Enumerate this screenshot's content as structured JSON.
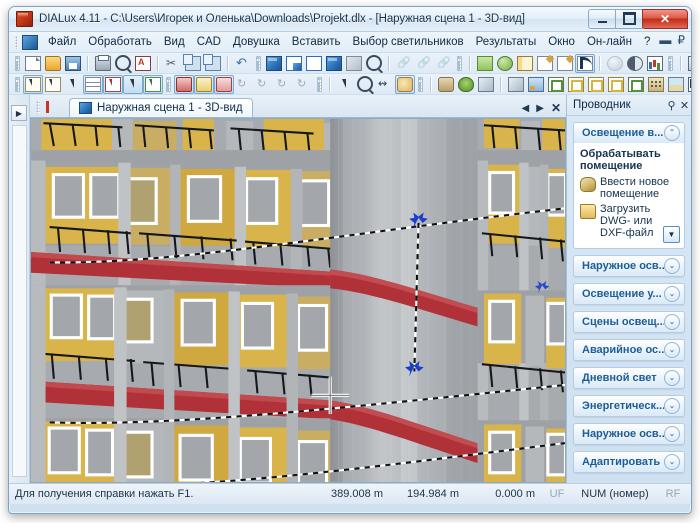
{
  "window": {
    "title": "DIALux 4.11 - C:\\Users\\Игорек и Оленька\\Downloads\\Projekt.dlx - [Наружная сцена 1 - 3D-вид]",
    "app_icon": "dialux-icon",
    "buttons": {
      "minimize": "–",
      "maximize": "□",
      "close": "✕"
    }
  },
  "menu": {
    "items": [
      {
        "label": "Файл"
      },
      {
        "label": "Обработать"
      },
      {
        "label": "Вид"
      },
      {
        "label": "CAD"
      },
      {
        "label": "Довушка"
      },
      {
        "label": "Вставить"
      },
      {
        "label": "Выбор светильников"
      },
      {
        "label": "Результаты"
      },
      {
        "label": "Окно"
      },
      {
        "label": "Он-лайн"
      },
      {
        "label": "?"
      }
    ],
    "mdi_restore": "▬",
    "mdi_close": "₽"
  },
  "toolbars": {
    "row1": [
      {
        "name": "new-document-icon",
        "glyph": "i-page"
      },
      {
        "name": "open-document-icon",
        "glyph": "i-folder"
      },
      {
        "name": "save-document-icon",
        "glyph": "i-disk"
      },
      {
        "name": "print-icon",
        "glyph": "i-print"
      },
      {
        "name": "print-preview-icon",
        "glyph": "i-mag"
      },
      {
        "name": "export-pdf-icon",
        "glyph": "i-pdf"
      },
      {
        "name": "cut-icon",
        "glyph": "i-scis"
      },
      {
        "name": "copy-icon",
        "glyph": "i-copy"
      },
      {
        "name": "paste-icon",
        "glyph": "i-copy"
      },
      {
        "name": "undo-icon",
        "glyph": "i-undo"
      }
    ],
    "row1b": [
      {
        "name": "view-3d-solid-icon",
        "glyph": "i-cube-b"
      },
      {
        "name": "view-plan-icon",
        "glyph": "i-lshape"
      },
      {
        "name": "view-wireframe-icon",
        "glyph": "i-cube-w"
      },
      {
        "name": "view-shaded-icon",
        "glyph": "i-cube-b"
      },
      {
        "name": "view-grey-icon",
        "glyph": "i-cube-g"
      },
      {
        "name": "zoom-window-icon",
        "glyph": "i-mag"
      },
      {
        "name": "link-icon",
        "glyph": "i-link"
      },
      {
        "name": "link-remove-icon",
        "glyph": "i-link"
      },
      {
        "name": "link-info-icon",
        "glyph": "i-link"
      }
    ],
    "row1c": [
      {
        "name": "lamp-catalog-icon",
        "glyph": "i-money"
      },
      {
        "name": "online-catalog-icon",
        "glyph": "i-globe"
      },
      {
        "name": "project-book-icon",
        "glyph": "i-book"
      },
      {
        "name": "edit-text-icon",
        "glyph": "i-pen"
      },
      {
        "name": "edit-object-icon",
        "glyph": "i-pen"
      },
      {
        "name": "curve-tool-icon",
        "glyph": "i-curve"
      },
      {
        "name": "sphere-icon",
        "glyph": "i-sphere"
      },
      {
        "name": "shading-icon",
        "glyph": "i-halfm"
      },
      {
        "name": "light-distribution-icon",
        "glyph": "i-chart"
      },
      {
        "name": "calculation-icon",
        "glyph": "i-calc"
      },
      {
        "name": "false-color-icon",
        "glyph": "i-colors"
      }
    ],
    "row2": [
      {
        "name": "select-object-icon",
        "glyph": "i-sel",
        "active": true
      },
      {
        "name": "select-lasso-icon",
        "glyph": "i-sel"
      },
      {
        "name": "select-pointer-icon",
        "glyph": "i-arrow2"
      },
      {
        "name": "select-table-icon",
        "glyph": "i-tbl",
        "active": true
      },
      {
        "name": "select-red-icon",
        "glyph": "i-redsel",
        "active": true
      },
      {
        "name": "select-area-icon",
        "glyph": "i-arrow2",
        "active": true
      },
      {
        "name": "select-green-icon",
        "glyph": "i-grnsel",
        "active": true
      }
    ],
    "row2b": [
      {
        "name": "luminaire-red-icon",
        "glyph": "i-lamp-d",
        "active": true
      },
      {
        "name": "luminaire-yellow-icon",
        "glyph": "i-lamp-y",
        "active": true
      },
      {
        "name": "luminaire-dark-icon",
        "glyph": "i-lamp-r",
        "active": true
      },
      {
        "name": "luminaire-dim1-icon",
        "glyph": "i-rot",
        "disabled": true
      },
      {
        "name": "luminaire-dim2-icon",
        "glyph": "i-rot",
        "disabled": true
      },
      {
        "name": "luminaire-dim3-icon",
        "glyph": "i-rot",
        "disabled": true
      },
      {
        "name": "luminaire-dim4-icon",
        "glyph": "i-rot",
        "disabled": true
      }
    ],
    "row2c": [
      {
        "name": "pointer-tool-icon",
        "glyph": "i-arrow2"
      },
      {
        "name": "zoom-tool-icon",
        "glyph": "i-mag"
      },
      {
        "name": "rotate-view-icon",
        "glyph": "i-rot"
      },
      {
        "name": "pan-hand-icon",
        "glyph": "i-hand",
        "active": true
      }
    ],
    "row2d": [
      {
        "name": "ground-object-icon",
        "glyph": "i-stone"
      },
      {
        "name": "tree-object-icon",
        "glyph": "i-tree"
      },
      {
        "name": "flag-object-icon",
        "glyph": "i-flag"
      },
      {
        "name": "wall-object-icon",
        "glyph": "i-flag"
      },
      {
        "name": "texture-icon",
        "glyph": "i-pic"
      },
      {
        "name": "luminaire-a-icon",
        "glyph": "i-lumn"
      },
      {
        "name": "luminaire-b-icon",
        "glyph": "i-lumy"
      },
      {
        "name": "luminaire-c-icon",
        "glyph": "i-lumy"
      },
      {
        "name": "luminaire-d-icon",
        "glyph": "i-lumy"
      },
      {
        "name": "luminaire-e-icon",
        "glyph": "i-lumn"
      },
      {
        "name": "building-icon",
        "glyph": "i-build"
      },
      {
        "name": "terrain-icon",
        "glyph": "i-mount"
      },
      {
        "name": "corner-icon",
        "glyph": "i-corner"
      }
    ]
  },
  "document": {
    "tab_label": "Наружная сцена 1 - 3D-вид",
    "tab_icon": "cube-icon",
    "nav_prev": "◀",
    "nav_next": "▶",
    "nav_close": "✕"
  },
  "left_dock": {
    "expand_label": "▶"
  },
  "explorer": {
    "title": "Проводник",
    "pin_icon": "pin-icon",
    "close_icon": "close-icon",
    "sections": [
      {
        "title": "Освещение в...",
        "expanded": true,
        "chevron": "⌃",
        "subtitle": "Обрабатывать помещение",
        "links": [
          {
            "icon": "room-icon",
            "label": "Ввести новое помещение"
          },
          {
            "icon": "dwg-file-icon",
            "label": "Загрузить DWG- или DXF-файл"
          }
        ],
        "more": "▼"
      },
      {
        "title": "Наружное осв...",
        "expanded": false,
        "chevron": "⌄"
      },
      {
        "title": "Освещение у...",
        "expanded": false,
        "chevron": "⌄"
      },
      {
        "title": "Сцены освещ...",
        "expanded": false,
        "chevron": "⌄"
      },
      {
        "title": "Аварийное ос...",
        "expanded": false,
        "chevron": "⌄"
      },
      {
        "title": "Дневной свет",
        "expanded": false,
        "chevron": "⌄"
      },
      {
        "title": "Энергетическ...",
        "expanded": false,
        "chevron": "⌄"
      },
      {
        "title": "Наружное осв...",
        "expanded": false,
        "chevron": "⌄"
      },
      {
        "title": "Адаптировать ...",
        "expanded": false,
        "chevron": "⌄"
      }
    ]
  },
  "status": {
    "hint": "Для получения справки нажать F1.",
    "coord_x": "389.008 m",
    "coord_y": "194.984 m",
    "coord_z": "0.000 m",
    "flag_uf": "UF",
    "flag_num": "NUM (номер)",
    "flag_rf": "RF"
  },
  "viewport": {
    "name": "3d-scene-viewport",
    "description": "3D-вид фасада здания: жёлтые и серые панели, красные полосы, балконные ограждения",
    "colors": {
      "facade_yellow": "#d9b44a",
      "facade_grey": "#a8abae",
      "accent_red": "#b03138",
      "column_grey": "#b9bcbf",
      "sky_grey": "#9ea5ab",
      "handle_blue": "#1b3fc8"
    }
  }
}
